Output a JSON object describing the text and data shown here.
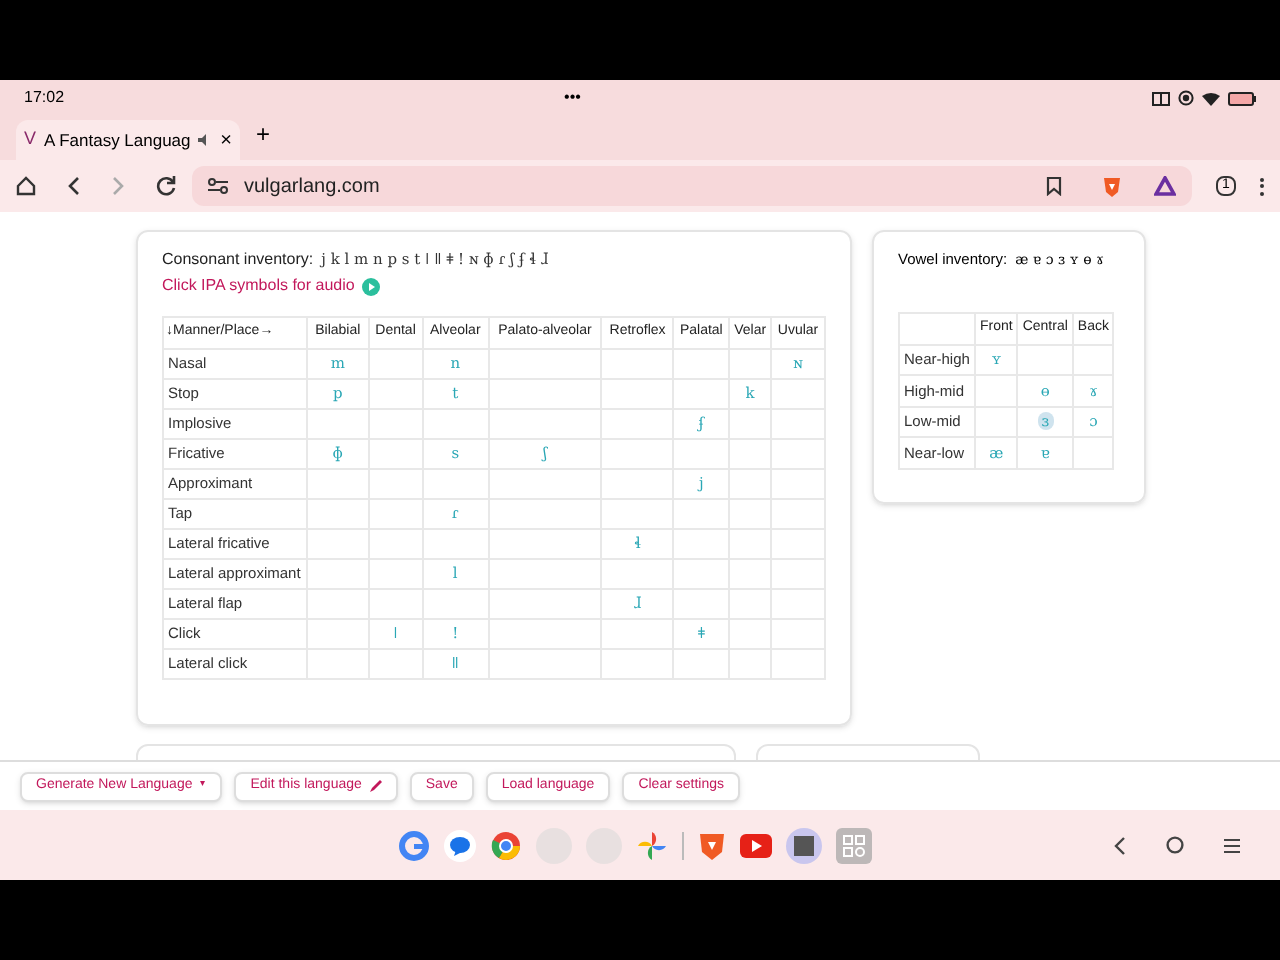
{
  "status_bar": {
    "time": "17:02",
    "menu_dots": "•••"
  },
  "tab": {
    "favicon": "V",
    "title": "A Fantasy Languag",
    "close": "×",
    "new_tab": "+"
  },
  "address_bar": {
    "url": "vulgarlang.com",
    "tab_count": "1"
  },
  "consonants": {
    "label": "Consonant inventory:",
    "inventory": "j k l m n p s t ǀ ǁ ǂ ! ɴ ɸ ɾ ʃ ʄ ɬ ɺ",
    "audio_hint": "Click IPA symbols for audio",
    "columns": [
      "↓Manner/Place→",
      "Bilabial",
      "Dental",
      "Alveolar",
      "Palato-alveolar",
      "Retroflex",
      "Palatal",
      "Velar",
      "Uvular"
    ],
    "rows": [
      {
        "cells": [
          "Nasal",
          "m",
          "",
          "n",
          "",
          "",
          "",
          "",
          "ɴ"
        ]
      },
      {
        "cells": [
          "Stop",
          "p",
          "",
          "t",
          "",
          "",
          "",
          "k",
          ""
        ]
      },
      {
        "cells": [
          "Implosive",
          "",
          "",
          "",
          "",
          "",
          "ʄ",
          "",
          ""
        ]
      },
      {
        "cells": [
          "Fricative",
          "ɸ",
          "",
          "s",
          "ʃ",
          "",
          "",
          "",
          ""
        ]
      },
      {
        "cells": [
          "Approximant",
          "",
          "",
          "",
          "",
          "",
          "j",
          "",
          ""
        ]
      },
      {
        "cells": [
          "Tap",
          "",
          "",
          "ɾ",
          "",
          "",
          "",
          "",
          ""
        ]
      },
      {
        "cells": [
          "Lateral fricative",
          "",
          "",
          "",
          "",
          "ɬ",
          "",
          "",
          ""
        ]
      },
      {
        "cells": [
          "Lateral approximant",
          "",
          "",
          "l",
          "",
          "",
          "",
          "",
          ""
        ]
      },
      {
        "cells": [
          "Lateral flap",
          "",
          "",
          "",
          "",
          "ɺ",
          "",
          "",
          ""
        ]
      },
      {
        "cells": [
          "Click",
          "",
          "ǀ",
          "!",
          "",
          "",
          "ǂ",
          "",
          ""
        ]
      },
      {
        "cells": [
          "Lateral click",
          "",
          "",
          "ǁ",
          "",
          "",
          "",
          "",
          ""
        ]
      }
    ]
  },
  "vowels": {
    "label": "Vowel inventory:",
    "inventory": "æ ɐ ɔ ɜ ʏ ɵ ɤ",
    "columns": [
      "Front",
      "Central",
      "Back"
    ],
    "rows": [
      {
        "label": "Near-high",
        "cells": [
          {
            "symbol": "ʏ",
            "selected": false
          },
          {
            "selected": false
          },
          {
            "selected": false
          }
        ]
      },
      {
        "label": "High-mid",
        "cells": [
          {
            "selected": false
          },
          {
            "symbol": "ɵ",
            "selected": false
          },
          {
            "symbol": "ɤ",
            "selected": false
          }
        ]
      },
      {
        "label": "Low-mid",
        "cells": [
          {
            "selected": false
          },
          {
            "symbol": "ɜ",
            "selected": true
          },
          {
            "symbol": "ɔ",
            "selected": false
          }
        ]
      },
      {
        "label": "Near-low",
        "cells": [
          {
            "symbol": "æ",
            "selected": false
          },
          {
            "symbol": "ɐ",
            "selected": false
          },
          {
            "selected": false
          }
        ]
      }
    ]
  },
  "actions": [
    {
      "label": "Generate New Language",
      "kind": "dropdown",
      "symbol": "▾"
    },
    {
      "label": "Edit this language",
      "kind": "edit"
    },
    {
      "label": "Save",
      "kind": "plain"
    },
    {
      "label": "Load language",
      "kind": "plain"
    },
    {
      "label": "Clear settings",
      "kind": "plain"
    }
  ]
}
